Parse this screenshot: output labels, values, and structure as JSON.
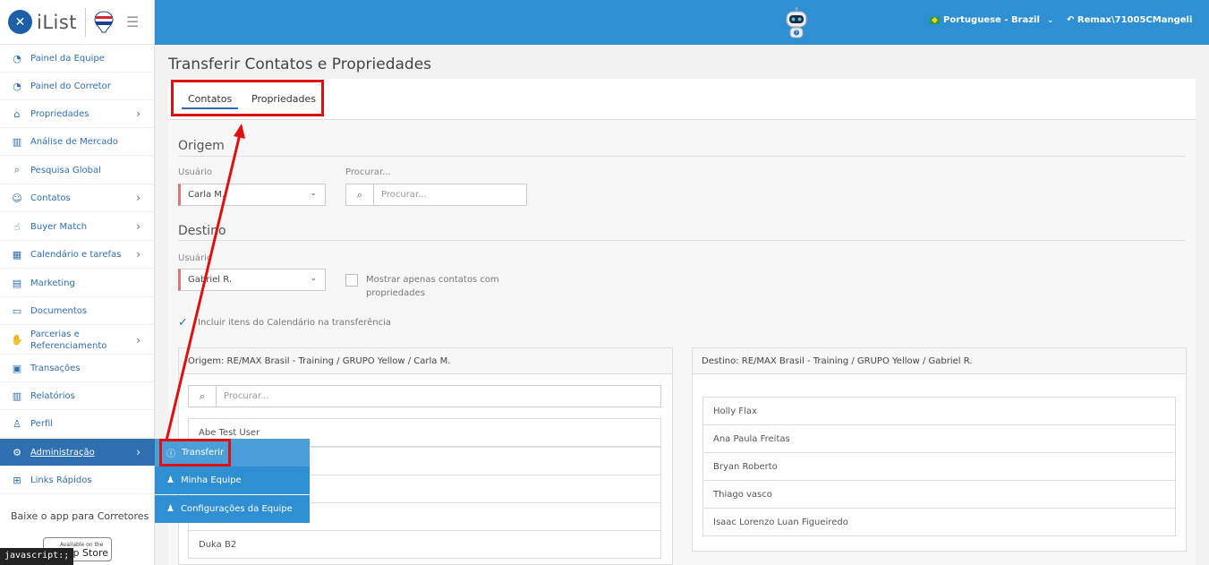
{
  "brand": {
    "logo_text": "iList"
  },
  "sidebar": {
    "items": [
      {
        "label": "Painel da Equipe",
        "icon": "dashboard-icon",
        "chevron": false
      },
      {
        "label": "Painel do Corretor",
        "icon": "dashboard-icon",
        "chevron": false
      },
      {
        "label": "Propriedades",
        "icon": "home-icon",
        "chevron": true
      },
      {
        "label": "Análise de Mercado",
        "icon": "bar-chart-icon",
        "chevron": false
      },
      {
        "label": "Pesquisa Global",
        "icon": "search-icon",
        "chevron": false
      },
      {
        "label": "Contatos",
        "icon": "contacts-icon",
        "chevron": true
      },
      {
        "label": "Buyer Match",
        "icon": "hand-icon",
        "chevron": true
      },
      {
        "label": "Calendário e tarefas",
        "icon": "calendar-icon",
        "chevron": true
      },
      {
        "label": "Marketing",
        "icon": "newspaper-icon",
        "chevron": false
      },
      {
        "label": "Documentos",
        "icon": "folder-icon",
        "chevron": false
      },
      {
        "label": "Parcerias e Referenciamento",
        "icon": "handshake-icon",
        "chevron": true
      },
      {
        "label": "Transações",
        "icon": "briefcase-icon",
        "chevron": false
      },
      {
        "label": "Relatórios",
        "icon": "bar-chart-icon",
        "chevron": false
      },
      {
        "label": "Perfil",
        "icon": "user-icon",
        "chevron": false
      },
      {
        "label": "Administração",
        "icon": "gear-icon",
        "chevron": true,
        "active": true
      },
      {
        "label": "Links Rápidos",
        "icon": "gift-icon",
        "chevron": false
      }
    ],
    "app_promo": "Baixe o app para Corretores",
    "appstore_small": "Available on the",
    "appstore_big": "App Store"
  },
  "status_bar": "javascript:;",
  "header": {
    "language": "Portuguese - Brazil",
    "user": "Remax\\71005CMangeli"
  },
  "admin_submenu": {
    "items": [
      {
        "label": "Transferir",
        "icon": "info-icon"
      },
      {
        "label": "Minha Equipe",
        "icon": "team-icon"
      },
      {
        "label": "Configurações da Equipe",
        "icon": "team-icon"
      }
    ]
  },
  "page": {
    "title": "Transferir Contatos e Propriedades",
    "tabs": [
      {
        "label": "Contatos",
        "active": true
      },
      {
        "label": "Propriedades",
        "active": false
      }
    ],
    "origem": {
      "title": "Origem",
      "user_label": "Usuário",
      "user_value": "Carla M.",
      "search_label": "Procurar...",
      "search_placeholder": "Procurar..."
    },
    "destino": {
      "title": "Destino",
      "user_label": "Usuário",
      "user_value": "Gabriel R.",
      "only_with_props_label": "Mostrar apenas contatos com propriedades"
    },
    "include_calendar_label": "Incluir itens do Calendário na transferência",
    "origin_panel": {
      "header": "Origem: RE/MAX Brasil - Training / GRUPO Yellow / Carla M.",
      "search_placeholder": "Procurar...",
      "items": [
        "Abe Test User",
        "",
        "",
        "",
        "Duka B2"
      ]
    },
    "dest_panel": {
      "header": "Destino: RE/MAX Brasil - Training / GRUPO Yellow / Gabriel R.",
      "items": [
        "Holly Flax",
        "Ana Paula Freitas",
        "Bryan Roberto",
        "Thiago vasco",
        "Isaac Lorenzo Luan Figueiredo"
      ]
    }
  },
  "colors": {
    "header_blue": "#2e8fd3",
    "nav_blue": "#2e6fb0",
    "annotation_red": "#e01010"
  }
}
